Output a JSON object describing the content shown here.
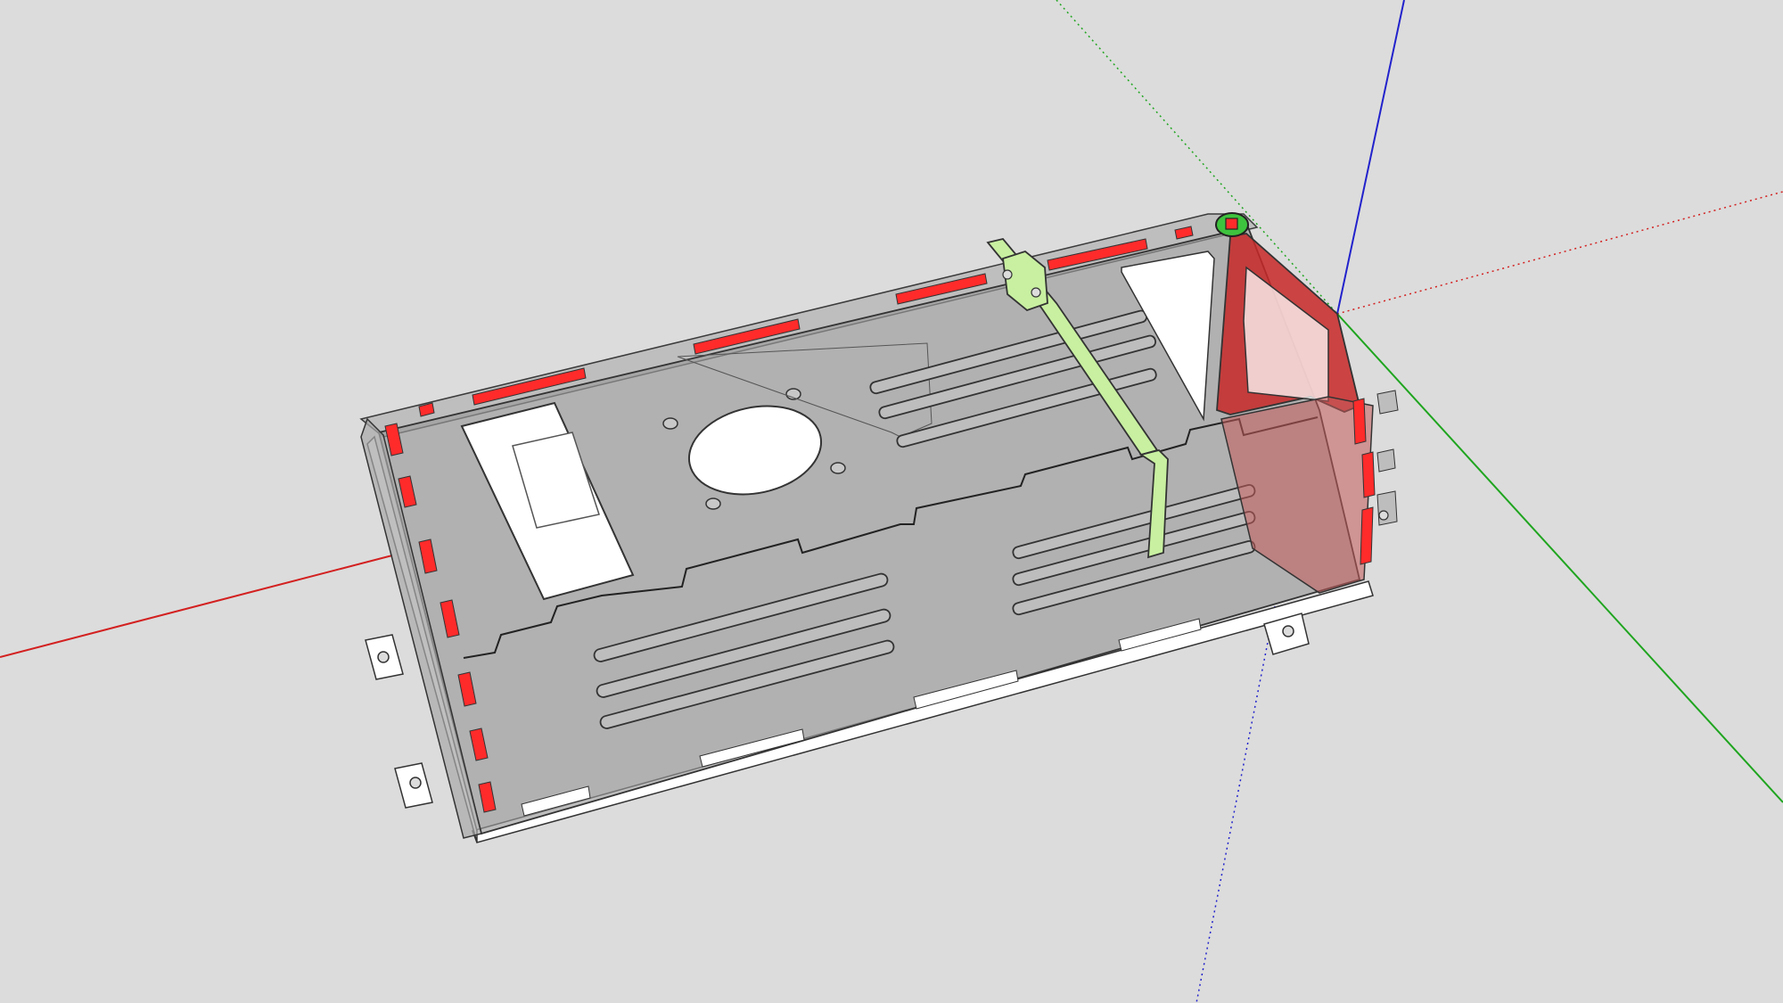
{
  "app": {
    "type": "3d-modeling-viewport",
    "background_color": "#dcdcdc"
  },
  "axes": {
    "red_axis_color": "#d32020",
    "green_axis_color": "#1fa51f",
    "blue_axis_color": "#2222cc",
    "show_origin_guides": true
  },
  "model": {
    "description_icon": "laser-cut-enclosure-model",
    "panel_fill_color": "#9a9a9a",
    "panel_edge_color": "#333333",
    "highlight_red_color": "#ff2b2b",
    "red_panel_color": "#c82828",
    "green_bracket_color": "#c8f0a0",
    "selected_circle_color": "#3ec33e",
    "floor_base_color": "#ffffff"
  }
}
